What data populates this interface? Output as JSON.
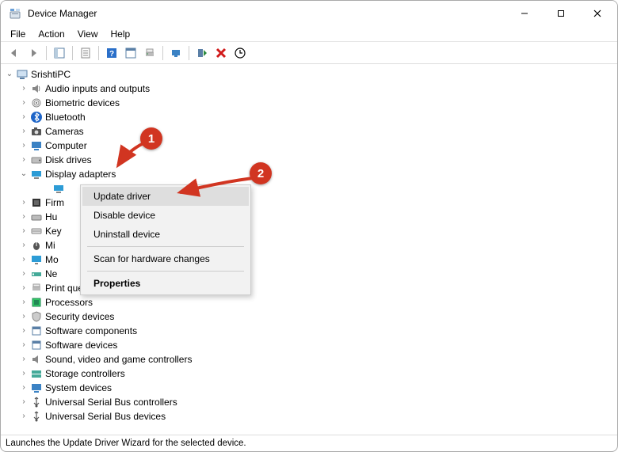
{
  "window": {
    "title": "Device Manager"
  },
  "menu": {
    "file": "File",
    "action": "Action",
    "view": "View",
    "help": "Help"
  },
  "tree": {
    "root": "SrishtiPC",
    "items": [
      "Audio inputs and outputs",
      "Biometric devices",
      "Bluetooth",
      "Cameras",
      "Computer",
      "Disk drives",
      "Display adapters",
      "Firm",
      "Hu",
      "Key",
      "Mi",
      "Mo",
      "Ne",
      "Print queues",
      "Processors",
      "Security devices",
      "Software components",
      "Software devices",
      "Sound, video and game controllers",
      "Storage controllers",
      "System devices",
      "Universal Serial Bus controllers",
      "Universal Serial Bus devices"
    ]
  },
  "context_menu": {
    "update": "Update driver",
    "disable": "Disable device",
    "uninstall": "Uninstall device",
    "scan": "Scan for hardware changes",
    "properties": "Properties"
  },
  "status": {
    "text": "Launches the Update Driver Wizard for the selected device."
  },
  "annotations": {
    "b1": "1",
    "b2": "2"
  }
}
